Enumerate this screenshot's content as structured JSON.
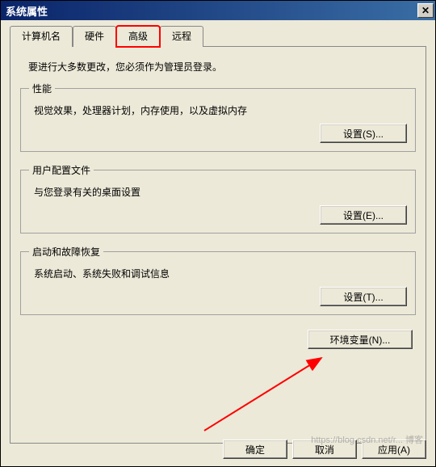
{
  "title": "系统属性",
  "close_glyph": "✕",
  "tabs": {
    "computer_name": "计算机名",
    "hardware": "硬件",
    "advanced": "高级",
    "remote": "远程"
  },
  "instruction": "要进行大多数更改，您必须作为管理员登录。",
  "groups": {
    "performance": {
      "legend": "性能",
      "desc": "视觉效果，处理器计划，内存使用，以及虚拟内存",
      "button": "设置(S)..."
    },
    "userprofiles": {
      "legend": "用户配置文件",
      "desc": "与您登录有关的桌面设置",
      "button": "设置(E)..."
    },
    "startup": {
      "legend": "启动和故障恢复",
      "desc": "系统启动、系统失败和调试信息",
      "button": "设置(T)..."
    }
  },
  "env_button": "环境变量(N)...",
  "bottom": {
    "ok": "确定",
    "cancel": "取消",
    "apply": "应用(A)"
  },
  "watermark": "https://blog.csdn.net/r... 博客"
}
